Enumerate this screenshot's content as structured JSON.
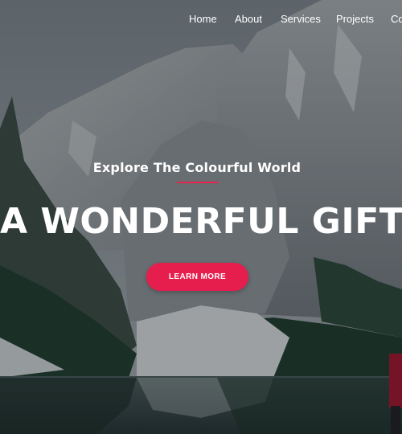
{
  "nav": {
    "items": [
      {
        "label": "Home"
      },
      {
        "label": "About"
      },
      {
        "label": "Services"
      },
      {
        "label": "Projects"
      },
      {
        "label": "Co"
      }
    ]
  },
  "hero": {
    "tagline": "Explore The Colourful World",
    "headline": "A WONDERFUL GIFT",
    "cta_label": "LEARN MORE"
  },
  "colors": {
    "accent": "#e61e4d",
    "sky": "#8c949a",
    "rock": "#9ea3a6",
    "forest": "#1f3a2a",
    "water": "#2b3a38"
  }
}
